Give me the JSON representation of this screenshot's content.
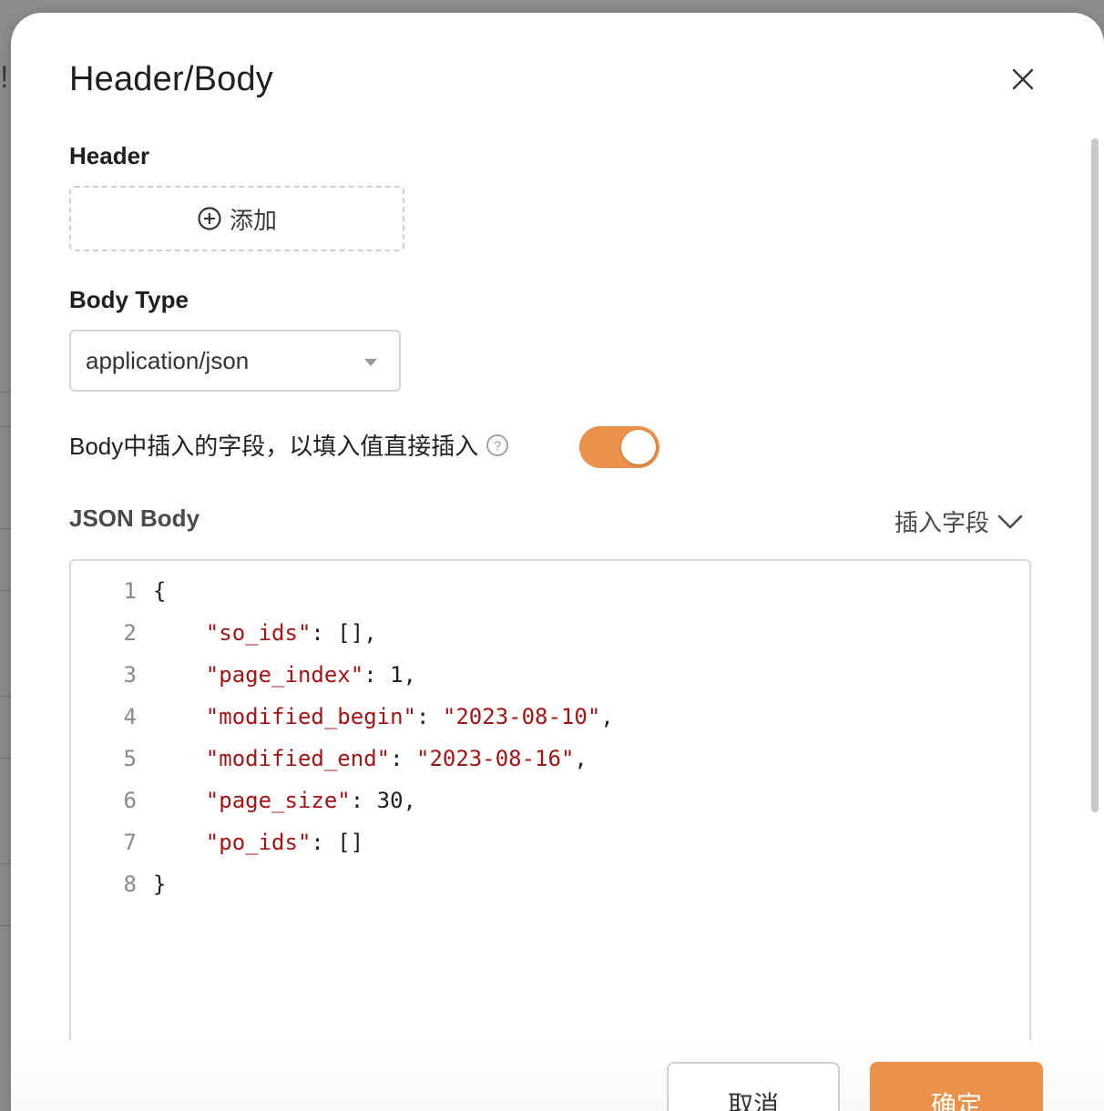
{
  "modal": {
    "title": "Header/Body"
  },
  "header_section": {
    "label": "Header",
    "add_label": "添加"
  },
  "body_type": {
    "label": "Body Type",
    "selected": "application/json"
  },
  "insert_toggle": {
    "label": "Body中插入的字段，以填入值直接插入",
    "enabled": true
  },
  "json_body": {
    "label": "JSON Body",
    "insert_field_label": "插入字段",
    "lines": [
      {
        "num": "1",
        "indent": "",
        "key": "",
        "sep": "",
        "value": "",
        "tail": "{"
      },
      {
        "num": "2",
        "indent": "    ",
        "key": "\"so_ids\"",
        "sep": ": ",
        "value": "",
        "tail": "[],"
      },
      {
        "num": "3",
        "indent": "    ",
        "key": "\"page_index\"",
        "sep": ": ",
        "value": "",
        "tail": "1,"
      },
      {
        "num": "4",
        "indent": "    ",
        "key": "\"modified_begin\"",
        "sep": ": ",
        "value": "\"2023-08-10\"",
        "tail": ","
      },
      {
        "num": "5",
        "indent": "    ",
        "key": "\"modified_end\"",
        "sep": ": ",
        "value": "\"2023-08-16\"",
        "tail": ","
      },
      {
        "num": "6",
        "indent": "    ",
        "key": "\"page_size\"",
        "sep": ": ",
        "value": "",
        "tail": "30,"
      },
      {
        "num": "7",
        "indent": "    ",
        "key": "\"po_ids\"",
        "sep": ": ",
        "value": "",
        "tail": "[]"
      },
      {
        "num": "8",
        "indent": "",
        "key": "",
        "sep": "",
        "value": "",
        "tail": "}"
      }
    ]
  },
  "footer": {
    "cancel_label": "取消",
    "ok_label": "确定"
  },
  "colors": {
    "accent": "#ec914a",
    "string": "#a31515"
  },
  "icons": {
    "close": "close-icon",
    "add": "plus-circle-icon",
    "select": "caret-down-icon",
    "help": "question-circle-icon",
    "insert": "chevron-down-icon"
  }
}
